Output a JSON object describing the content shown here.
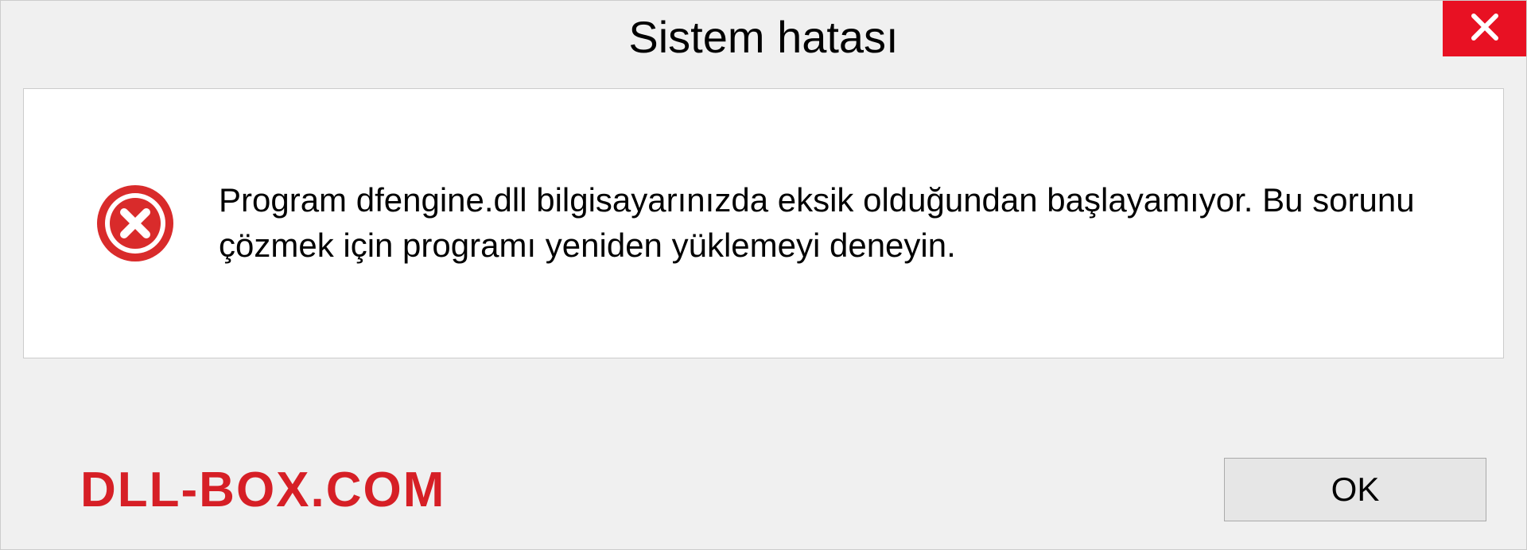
{
  "titlebar": {
    "title": "Sistem hatası"
  },
  "message": {
    "text": "Program dfengine.dll bilgisayarınızda eksik olduğundan başlayamıyor. Bu sorunu çözmek için programı yeniden yüklemeyi deneyin."
  },
  "footer": {
    "watermark": "DLL-BOX.COM",
    "ok_label": "OK"
  },
  "icons": {
    "close": "close-icon",
    "error": "error-icon"
  },
  "colors": {
    "close_bg": "#e81123",
    "error_red": "#d92b2b",
    "watermark": "#d61f26"
  }
}
